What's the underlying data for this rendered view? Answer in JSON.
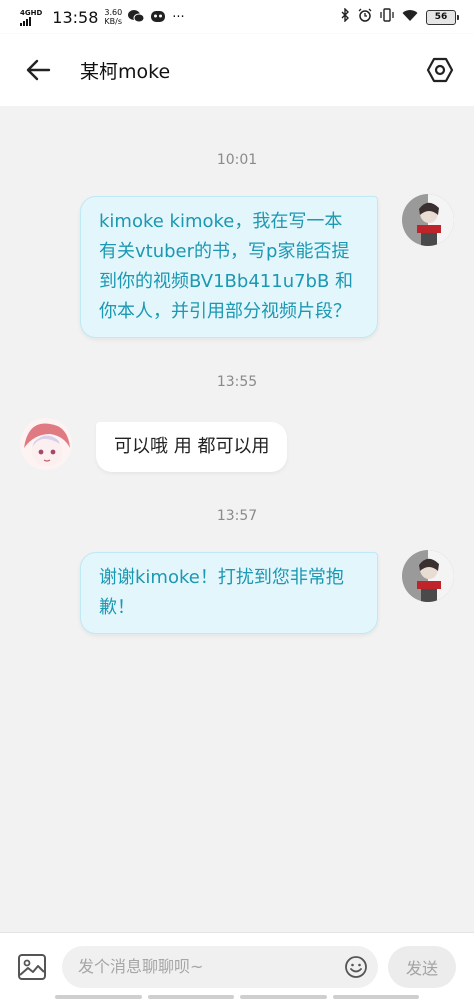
{
  "status_bar": {
    "network_type": "4GHD",
    "time": "13:58",
    "speed_value": "3.60",
    "speed_unit": "KB/s",
    "more": "···",
    "battery": "56"
  },
  "header": {
    "title": "某柯moke"
  },
  "messages": [
    {
      "timestamp": "10:01",
      "direction": "outgoing",
      "text": "kimoke kimoke，我在写一本有关vtuber的书，写p家能否提到你的视频BV1Bb411u7bB 和你本人，并引用部分视频片段？"
    },
    {
      "timestamp": "13:55",
      "direction": "incoming",
      "text": "可以哦 用 都可以用"
    },
    {
      "timestamp": "13:57",
      "direction": "outgoing",
      "text": "谢谢kimoke！打扰到您非常抱歉！"
    }
  ],
  "composer": {
    "placeholder": "发个消息聊聊呗~",
    "send_label": "发送"
  },
  "colors": {
    "outgoing_bubble_bg": "#e3f6fc",
    "outgoing_text": "#1b98b2",
    "incoming_bubble_bg": "#ffffff",
    "background": "#f2f2f2"
  }
}
